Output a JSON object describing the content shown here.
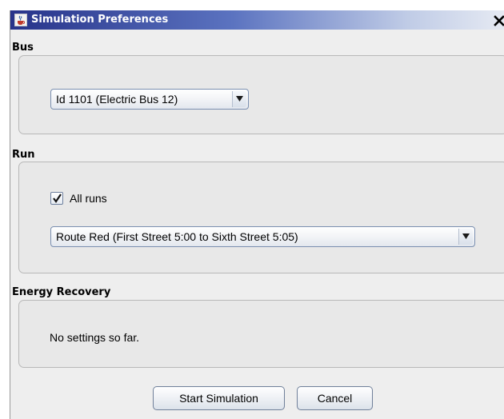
{
  "window": {
    "title": "Simulation Preferences",
    "close_glyph": "✕",
    "icon": "java-cup-icon"
  },
  "bus_section": {
    "label": "Bus",
    "selected_bus": "Id 1101 (Electric Bus 12)"
  },
  "run_section": {
    "label": "Run",
    "all_runs_label": "All runs",
    "all_runs_checked": true,
    "selected_run": "Route Red (First Street 5:00 to Sixth Street 5:05)"
  },
  "energy_section": {
    "label": "Energy Recovery",
    "message": "No settings so far."
  },
  "actions": {
    "start_label": "Start Simulation",
    "cancel_label": "Cancel"
  }
}
